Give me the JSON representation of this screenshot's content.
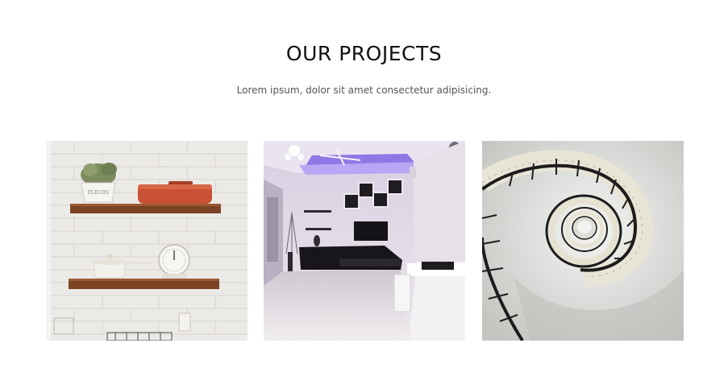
{
  "section": {
    "title": "OUR PROJECTS",
    "subtitle": "Lorem ipsum, dolor sit amet consectetur adipisicing."
  },
  "projects": [
    {
      "image": "kitchen-shelves-photo"
    },
    {
      "image": "living-room-interior-photo"
    },
    {
      "image": "spiral-staircase-photo"
    }
  ]
}
